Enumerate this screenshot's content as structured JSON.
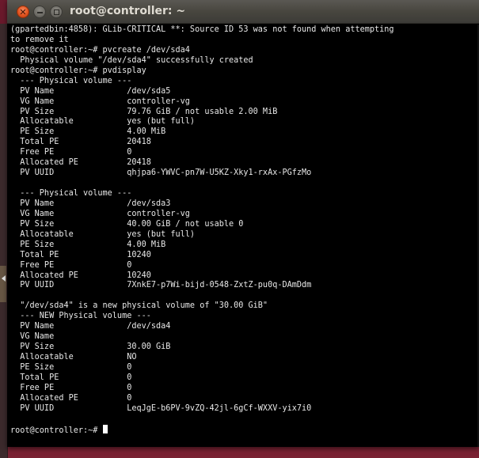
{
  "window": {
    "title": "root@controller: ~",
    "close_glyph": "✕"
  },
  "terminal": {
    "lines": [
      "(gpartedbin:4858): GLib-CRITICAL **: Source ID 53 was not found when attempting",
      "to remove it",
      "root@controller:~# pvcreate /dev/sda4",
      "  Physical volume \"/dev/sda4\" successfully created",
      "root@controller:~# pvdisplay",
      "  --- Physical volume ---",
      "  PV Name               /dev/sda5",
      "  VG Name               controller-vg",
      "  PV Size               79.76 GiB / not usable 2.00 MiB",
      "  Allocatable           yes (but full)",
      "  PE Size               4.00 MiB",
      "  Total PE              20418",
      "  Free PE               0",
      "  Allocated PE          20418",
      "  PV UUID               qhjpa6-YWVC-pn7W-U5KZ-Xky1-rxAx-PGfzMo",
      "",
      "  --- Physical volume ---",
      "  PV Name               /dev/sda3",
      "  VG Name               controller-vg",
      "  PV Size               40.00 GiB / not usable 0",
      "  Allocatable           yes (but full)",
      "  PE Size               4.00 MiB",
      "  Total PE              10240",
      "  Free PE               0",
      "  Allocated PE          10240",
      "  PV UUID               7XnkE7-p7Wi-bijd-0548-ZxtZ-pu0q-DAmDdm",
      "",
      "  \"/dev/sda4\" is a new physical volume of \"30.00 GiB\"",
      "  --- NEW Physical volume ---",
      "  PV Name               /dev/sda4",
      "  VG Name",
      "  PV Size               30.00 GiB",
      "  Allocatable           NO",
      "  PE Size               0",
      "  Total PE              0",
      "  Free PE               0",
      "  Allocated PE          0",
      "  PV UUID               LeqJgE-b6PV-9vZQ-42jl-6gCf-WXXV-yix7i0",
      "",
      "root@controller:~# "
    ]
  },
  "colors": {
    "terminal_bg": "#000000",
    "terminal_fg": "#e8e8e8",
    "close_button": "#e2531f",
    "titlebar": "#3c3b37"
  },
  "icons": {
    "close": "close-icon",
    "minimize": "minimize-icon",
    "maximize": "maximize-icon",
    "cursor": "block-cursor"
  }
}
